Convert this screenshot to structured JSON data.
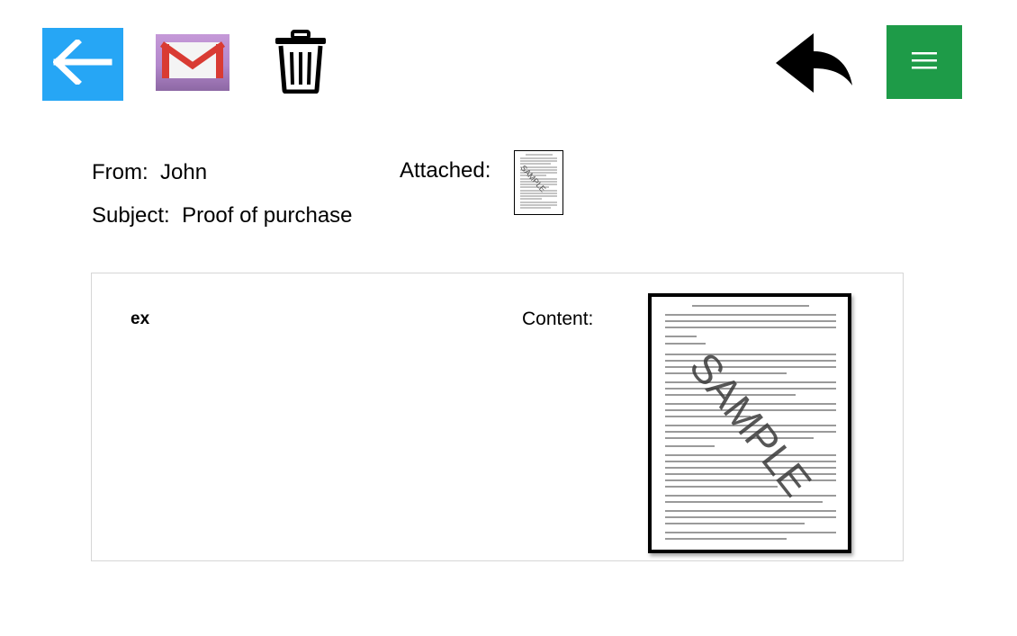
{
  "toolbar": {
    "back": {
      "icon": "arrow-left-icon",
      "color": "#26a6f5"
    },
    "mail": {
      "icon": "gmail-envelope-icon",
      "color": "#b388cc"
    },
    "trash": {
      "icon": "trash-can-icon"
    },
    "reply": {
      "icon": "reply-arrow-icon"
    },
    "menu": {
      "icon": "hamburger-menu-icon",
      "color": "#1e9b48"
    }
  },
  "header": {
    "from_label": "From:",
    "from_value": "John",
    "subject_label": "Subject:",
    "subject_value": "Proof of purchase",
    "attached_label": "Attached:",
    "attachment": {
      "icon": "document-thumbnail-icon",
      "watermark": "SAMPLE"
    }
  },
  "message": {
    "body_text": "ex",
    "content_label": "Content:",
    "content_document": {
      "icon": "document-preview",
      "watermark": "SAMPLE"
    }
  }
}
